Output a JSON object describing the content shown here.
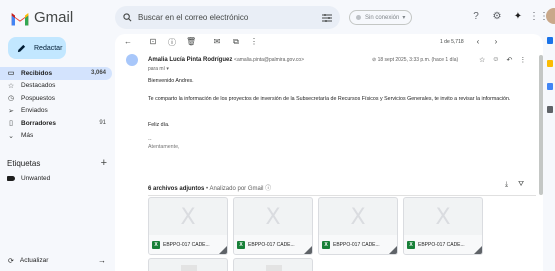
{
  "app": {
    "name": "Gmail"
  },
  "search": {
    "placeholder": "Buscar en el correo electrónico"
  },
  "status": {
    "label": "Sin conexión"
  },
  "compose": {
    "label": "Redactar"
  },
  "nav": [
    {
      "label": "Recibidos",
      "count": "3,064",
      "icon": "inbox-icon",
      "active": true
    },
    {
      "label": "Destacados",
      "count": "",
      "icon": "star-icon"
    },
    {
      "label": "Pospuestos",
      "count": "",
      "icon": "clock-icon"
    },
    {
      "label": "Enviados",
      "count": "",
      "icon": "send-icon"
    },
    {
      "label": "Borradores",
      "count": "91",
      "icon": "draft-icon",
      "bold": true
    },
    {
      "label": "Más",
      "count": "",
      "icon": "chevron-down-icon"
    }
  ],
  "labels": {
    "title": "Etiquetas",
    "items": [
      {
        "label": "Unwanted"
      }
    ]
  },
  "refresh": {
    "label": "Actualizar"
  },
  "toolbar": {
    "page_count": "1 de 5,718"
  },
  "message": {
    "sender_name": "Amalia Lucía Pinta Rodríguez",
    "sender_email": "<amalia.pinta@palmira.gov.co>",
    "to": "para mí",
    "date": "18 sept 2025, 3:33 p.m. (hace 1 día)",
    "greeting": "Bienvenido Andres.",
    "body": "Te comparto la información de los proyectos de inversión de la Subsecretaría de Recursos Físicos y Servicios Generales, te invito a revisar la información.",
    "closing": "Feliz día.",
    "sig_dash": "--",
    "signature": "Atentamente,"
  },
  "attachments": {
    "count_label": "6 archivos adjuntos",
    "scan_label": "Analizado por Gmail",
    "files": [
      {
        "name": "EBPPO-017 CADE..."
      },
      {
        "name": "EBPPO-017 CADE..."
      },
      {
        "name": "EBPPO-017 CADE..."
      },
      {
        "name": "EBPPO-017 CADE..."
      }
    ]
  },
  "colors": {
    "accent": "#c2e7ff",
    "active_nav": "#d3e3fd",
    "sheets_green": "#188038"
  }
}
